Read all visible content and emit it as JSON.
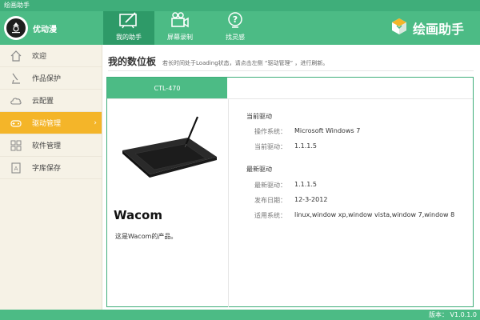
{
  "window": {
    "title": "绘画助手"
  },
  "user": {
    "name": "优动漫",
    "avatar_label": "UGOCOMI"
  },
  "nav": {
    "tabs": [
      {
        "label": "我的助手",
        "icon": "drawing-board-icon",
        "active": true
      },
      {
        "label": "屏幕录制",
        "icon": "video-camera-icon",
        "active": false
      },
      {
        "label": "找灵感",
        "icon": "lightbulb-icon",
        "active": false
      }
    ]
  },
  "brand": {
    "text": "绘画助手",
    "icon": "cube-logo-icon"
  },
  "sidebar": {
    "items": [
      {
        "label": "欢迎",
        "icon": "home-icon"
      },
      {
        "label": "作品保护",
        "icon": "brush-icon"
      },
      {
        "label": "云配置",
        "icon": "cloud-icon"
      },
      {
        "label": "驱动管理",
        "icon": "gamepad-icon",
        "active": true
      },
      {
        "label": "软件管理",
        "icon": "grid-icon"
      },
      {
        "label": "字库保存",
        "icon": "font-book-icon"
      }
    ]
  },
  "main": {
    "title": "我的数位板",
    "hint": "若长时间处于Loading状态，请点击左侧 “驱动管理” ，进行刷新。",
    "device_tab": "CTL-470",
    "brand_name": "Wacom",
    "product_desc": "这是Wacom的产品。",
    "current_driver": {
      "section_title": "当前驱动",
      "os_label": "操作系统：",
      "os_value": "Microsoft Windows 7",
      "driver_label": "当前驱动：",
      "driver_value": "1.1.1.5"
    },
    "latest_driver": {
      "section_title": "最新驱动",
      "driver_label": "最新驱动：",
      "driver_value": "1.1.1.5",
      "date_label": "发布日期：",
      "date_value": "12-3-2012",
      "systems_label": "适用系统：",
      "systems_value": "linux,window xp,window vista,window 7,window 8"
    }
  },
  "status": {
    "version": "版本： V1.0.1.0"
  },
  "colors": {
    "primary_green": "#4cbb85",
    "dark_green": "#2e9a68",
    "active_orange": "#f4b529",
    "sidebar_bg": "#f6f2e6"
  }
}
